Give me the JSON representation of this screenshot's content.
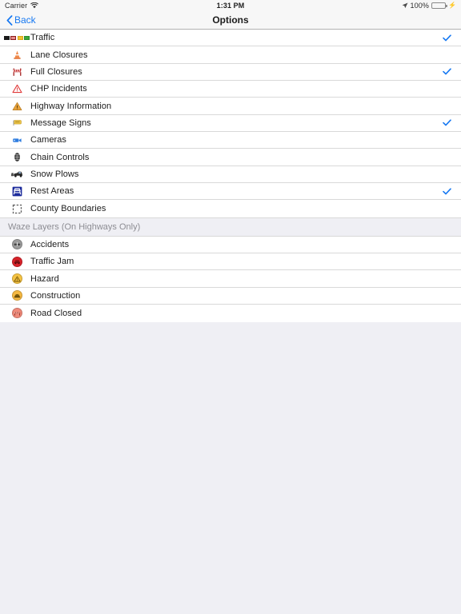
{
  "status_bar": {
    "carrier": "Carrier",
    "wifi_icon": "wifi-icon",
    "time": "1:31 PM",
    "location_icon": "location-arrow-icon",
    "battery_percent": "100%",
    "battery_icon": "battery-full-icon",
    "charging_icon": "lightning-bolt-icon",
    "battery_color": "#4cd964"
  },
  "navbar": {
    "back_label": "Back",
    "back_icon": "chevron-left-icon",
    "title": "Options",
    "tint_color": "#1779f2"
  },
  "sections": [
    {
      "header": null,
      "rows": [
        {
          "label": "Traffic",
          "icon": "traffic-legend-icon",
          "checked": true
        },
        {
          "label": "Lane Closures",
          "icon": "traffic-cone-icon",
          "checked": false
        },
        {
          "label": "Full Closures",
          "icon": "road-barrier-icon",
          "checked": true
        },
        {
          "label": "CHP Incidents",
          "icon": "warning-triangle-outline-icon",
          "checked": false
        },
        {
          "label": "Highway Information",
          "icon": "warning-triangle-filled-icon",
          "checked": false
        },
        {
          "label": "Message Signs",
          "icon": "message-sign-icon",
          "checked": true
        },
        {
          "label": "Cameras",
          "icon": "video-camera-icon",
          "checked": false
        },
        {
          "label": "Chain Controls",
          "icon": "tire-chain-icon",
          "checked": false
        },
        {
          "label": "Snow Plows",
          "icon": "snow-plow-icon",
          "checked": false
        },
        {
          "label": "Rest Areas",
          "icon": "rest-area-picnic-icon",
          "checked": true
        },
        {
          "label": "County Boundaries",
          "icon": "dashed-square-icon",
          "checked": false
        }
      ]
    },
    {
      "header": "Waze Layers (On Highways Only)",
      "rows": [
        {
          "label": "Accidents",
          "icon": "waze-accident-icon",
          "checked": false,
          "bubble_color": "#9b9b9b"
        },
        {
          "label": "Traffic Jam",
          "icon": "waze-traffic-jam-icon",
          "checked": false,
          "bubble_color": "#d8232a"
        },
        {
          "label": "Hazard",
          "icon": "waze-hazard-icon",
          "checked": false,
          "bubble_color": "#f5c343"
        },
        {
          "label": "Construction",
          "icon": "waze-construction-icon",
          "checked": false,
          "bubble_color": "#f5b841"
        },
        {
          "label": "Road Closed",
          "icon": "waze-road-closed-icon",
          "checked": false,
          "bubble_color": "#f08a7a"
        }
      ]
    }
  ],
  "traffic_legend_colors": [
    "#1a1a1a",
    "#8b1a1a",
    "#f2c230",
    "#3aa63a"
  ],
  "checkmark_color": "#1779f2",
  "colors": {
    "page_background": "#efeff4",
    "row_background": "#ffffff",
    "separator": "#d9d9d9",
    "primary_text": "#1c1c1c",
    "secondary_text": "#8d8d93"
  }
}
